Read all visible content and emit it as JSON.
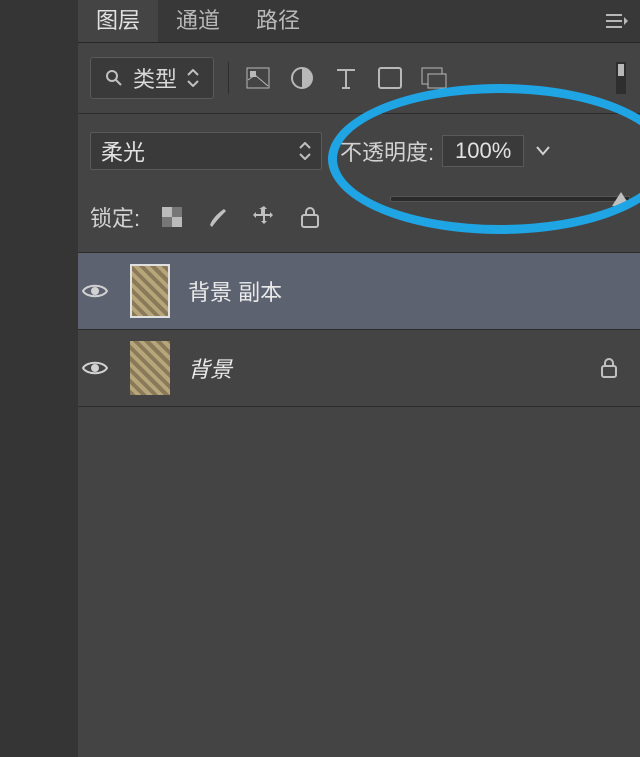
{
  "tabs": {
    "layers": "图层",
    "channels": "通道",
    "paths": "路径"
  },
  "filter": {
    "type_label": "类型"
  },
  "blend": {
    "mode": "柔光",
    "opacity_label": "不透明度:",
    "opacity_value": "100%"
  },
  "lock": {
    "label": "锁定:"
  },
  "layers": [
    {
      "name": "背景 副本",
      "visible": true,
      "locked": false,
      "selected": true
    },
    {
      "name": "背景",
      "visible": true,
      "locked": true,
      "selected": false
    }
  ],
  "colors": {
    "accent": "#1fa4e4"
  }
}
